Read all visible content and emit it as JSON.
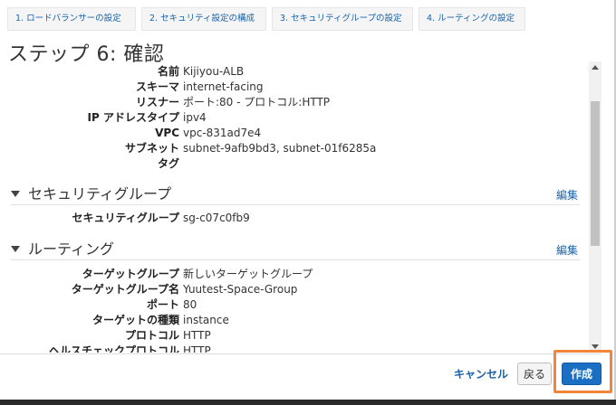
{
  "wizard": {
    "tabs": [
      "1. ロードバランサーの設定",
      "2. セキュリティ設定の構成",
      "3. セキュリティグループの設定",
      "4. ルーティングの設定"
    ]
  },
  "page": {
    "title": "ステップ 6: 確認"
  },
  "load_balancer": {
    "rows": [
      {
        "label": "名前",
        "value": "Kijiyou-ALB"
      },
      {
        "label": "スキーマ",
        "value": "internet-facing"
      },
      {
        "label": "リスナー",
        "value": "ポート:80 - プロトコル:HTTP"
      },
      {
        "label": "IP アドレスタイプ",
        "value": "ipv4"
      },
      {
        "label": "VPC",
        "value": "vpc-831ad7e4"
      },
      {
        "label": "サブネット",
        "value": "subnet-9afb9bd3, subnet-01f6285a"
      },
      {
        "label": "タグ",
        "value": ""
      }
    ]
  },
  "security_section": {
    "title": "セキュリティグループ",
    "edit": "編集",
    "rows": [
      {
        "label": "セキュリティグループ",
        "value": "sg-c07c0fb9"
      }
    ]
  },
  "routing_section": {
    "title": "ルーティング",
    "edit": "編集",
    "rows": [
      {
        "label": "ターゲットグループ",
        "value": "新しいターゲットグループ"
      },
      {
        "label": "ターゲットグループ名",
        "value": "Yuutest-Space-Group"
      },
      {
        "label": "ポート",
        "value": "80"
      },
      {
        "label": "ターゲットの種類",
        "value": "instance"
      },
      {
        "label": "プロトコル",
        "value": "HTTP"
      },
      {
        "label": "ヘルスチェックプロトコル",
        "value": "HTTP"
      }
    ]
  },
  "footer": {
    "cancel": "キャンセル",
    "back": "戻る",
    "create": "作成"
  },
  "colors": {
    "link": "#1a62a8",
    "primary_button": "#1a6fc4",
    "highlight": "#f0853b"
  }
}
